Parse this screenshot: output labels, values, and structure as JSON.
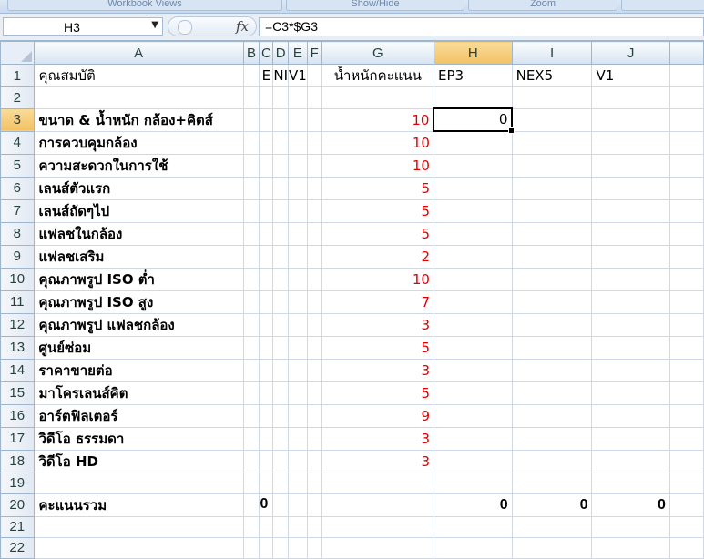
{
  "ribbon": {
    "groups": [
      "Workbook Views",
      "Show/Hide",
      "Zoom"
    ]
  },
  "formula_bar": {
    "name_box": "H3",
    "fx_symbol": "fx",
    "formula": "=C3*$G3"
  },
  "columns": [
    "A",
    "B",
    "C",
    "D",
    "E",
    "F",
    "G",
    "H",
    "I",
    "J"
  ],
  "selected_column": "H",
  "selected_row": "3",
  "header_row": {
    "row": "1",
    "A": "คุณสมบัติ",
    "C": "E",
    "D": "NI",
    "E": "V1",
    "G": "น้ำหนักคะแนน",
    "H": "EP3",
    "I": "NEX5",
    "J": "V1"
  },
  "rows": [
    {
      "row": "2",
      "A": "",
      "G": ""
    },
    {
      "row": "3",
      "A": "ขนาด & น้ำหนัก กล้อง+คิตส์",
      "G": "10",
      "H": "0"
    },
    {
      "row": "4",
      "A": "การควบคุมกล้อง",
      "G": "10"
    },
    {
      "row": "5",
      "A": "ความสะดวกในการใช้",
      "G": "10"
    },
    {
      "row": "6",
      "A": "เลนส์ตัวแรก",
      "G": "5"
    },
    {
      "row": "7",
      "A": "เลนส์ถัดๆไป",
      "G": "5"
    },
    {
      "row": "8",
      "A": "แฟลชในกล้อง",
      "G": "5"
    },
    {
      "row": "9",
      "A": "แฟลชเสริม",
      "G": "2"
    },
    {
      "row": "10",
      "A": "คุณภาพรูป ISO ต่ำ",
      "G": "10"
    },
    {
      "row": "11",
      "A": "คุณภาพรูป ISO สูง",
      "G": "7"
    },
    {
      "row": "12",
      "A": "คุณภาพรูป แฟลชกล้อง",
      "G": "3"
    },
    {
      "row": "13",
      "A": "ศูนย์ซ่อม",
      "G": "5"
    },
    {
      "row": "14",
      "A": "ราคาขายต่อ",
      "G": "3"
    },
    {
      "row": "15",
      "A": "มาโครเลนส์คิต",
      "G": "5"
    },
    {
      "row": "16",
      "A": "อาร์ตฟิลเตอร์",
      "G": "9"
    },
    {
      "row": "17",
      "A": "วิดีโอ ธรรมดา",
      "G": "3"
    },
    {
      "row": "18",
      "A": "วิดีโอ HD",
      "G": "3"
    },
    {
      "row": "19",
      "A": "",
      "G": ""
    }
  ],
  "total_row": {
    "row": "20",
    "A": "คะแนนรวม",
    "C": "0",
    "H": "0",
    "I": "0",
    "J": "0"
  },
  "tail_rows": [
    "21",
    "22"
  ]
}
